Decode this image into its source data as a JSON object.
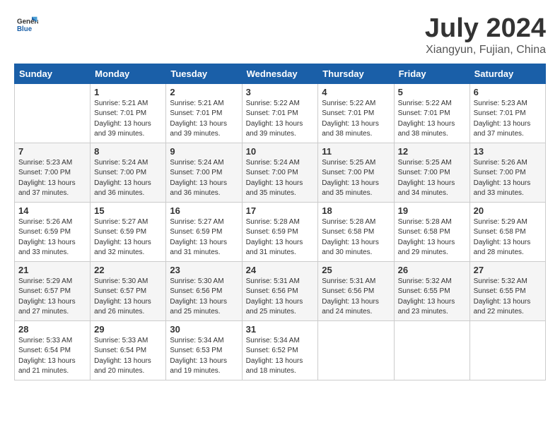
{
  "header": {
    "logo_general": "General",
    "logo_blue": "Blue",
    "month_title": "July 2024",
    "location": "Xiangyun, Fujian, China"
  },
  "weekdays": [
    "Sunday",
    "Monday",
    "Tuesday",
    "Wednesday",
    "Thursday",
    "Friday",
    "Saturday"
  ],
  "weeks": [
    [
      {
        "day": "",
        "sunrise": "",
        "sunset": "",
        "daylight": ""
      },
      {
        "day": "1",
        "sunrise": "Sunrise: 5:21 AM",
        "sunset": "Sunset: 7:01 PM",
        "daylight": "Daylight: 13 hours and 39 minutes."
      },
      {
        "day": "2",
        "sunrise": "Sunrise: 5:21 AM",
        "sunset": "Sunset: 7:01 PM",
        "daylight": "Daylight: 13 hours and 39 minutes."
      },
      {
        "day": "3",
        "sunrise": "Sunrise: 5:22 AM",
        "sunset": "Sunset: 7:01 PM",
        "daylight": "Daylight: 13 hours and 39 minutes."
      },
      {
        "day": "4",
        "sunrise": "Sunrise: 5:22 AM",
        "sunset": "Sunset: 7:01 PM",
        "daylight": "Daylight: 13 hours and 38 minutes."
      },
      {
        "day": "5",
        "sunrise": "Sunrise: 5:22 AM",
        "sunset": "Sunset: 7:01 PM",
        "daylight": "Daylight: 13 hours and 38 minutes."
      },
      {
        "day": "6",
        "sunrise": "Sunrise: 5:23 AM",
        "sunset": "Sunset: 7:01 PM",
        "daylight": "Daylight: 13 hours and 37 minutes."
      }
    ],
    [
      {
        "day": "7",
        "sunrise": "Sunrise: 5:23 AM",
        "sunset": "Sunset: 7:00 PM",
        "daylight": "Daylight: 13 hours and 37 minutes."
      },
      {
        "day": "8",
        "sunrise": "Sunrise: 5:24 AM",
        "sunset": "Sunset: 7:00 PM",
        "daylight": "Daylight: 13 hours and 36 minutes."
      },
      {
        "day": "9",
        "sunrise": "Sunrise: 5:24 AM",
        "sunset": "Sunset: 7:00 PM",
        "daylight": "Daylight: 13 hours and 36 minutes."
      },
      {
        "day": "10",
        "sunrise": "Sunrise: 5:24 AM",
        "sunset": "Sunset: 7:00 PM",
        "daylight": "Daylight: 13 hours and 35 minutes."
      },
      {
        "day": "11",
        "sunrise": "Sunrise: 5:25 AM",
        "sunset": "Sunset: 7:00 PM",
        "daylight": "Daylight: 13 hours and 35 minutes."
      },
      {
        "day": "12",
        "sunrise": "Sunrise: 5:25 AM",
        "sunset": "Sunset: 7:00 PM",
        "daylight": "Daylight: 13 hours and 34 minutes."
      },
      {
        "day": "13",
        "sunrise": "Sunrise: 5:26 AM",
        "sunset": "Sunset: 7:00 PM",
        "daylight": "Daylight: 13 hours and 33 minutes."
      }
    ],
    [
      {
        "day": "14",
        "sunrise": "Sunrise: 5:26 AM",
        "sunset": "Sunset: 6:59 PM",
        "daylight": "Daylight: 13 hours and 33 minutes."
      },
      {
        "day": "15",
        "sunrise": "Sunrise: 5:27 AM",
        "sunset": "Sunset: 6:59 PM",
        "daylight": "Daylight: 13 hours and 32 minutes."
      },
      {
        "day": "16",
        "sunrise": "Sunrise: 5:27 AM",
        "sunset": "Sunset: 6:59 PM",
        "daylight": "Daylight: 13 hours and 31 minutes."
      },
      {
        "day": "17",
        "sunrise": "Sunrise: 5:28 AM",
        "sunset": "Sunset: 6:59 PM",
        "daylight": "Daylight: 13 hours and 31 minutes."
      },
      {
        "day": "18",
        "sunrise": "Sunrise: 5:28 AM",
        "sunset": "Sunset: 6:58 PM",
        "daylight": "Daylight: 13 hours and 30 minutes."
      },
      {
        "day": "19",
        "sunrise": "Sunrise: 5:28 AM",
        "sunset": "Sunset: 6:58 PM",
        "daylight": "Daylight: 13 hours and 29 minutes."
      },
      {
        "day": "20",
        "sunrise": "Sunrise: 5:29 AM",
        "sunset": "Sunset: 6:58 PM",
        "daylight": "Daylight: 13 hours and 28 minutes."
      }
    ],
    [
      {
        "day": "21",
        "sunrise": "Sunrise: 5:29 AM",
        "sunset": "Sunset: 6:57 PM",
        "daylight": "Daylight: 13 hours and 27 minutes."
      },
      {
        "day": "22",
        "sunrise": "Sunrise: 5:30 AM",
        "sunset": "Sunset: 6:57 PM",
        "daylight": "Daylight: 13 hours and 26 minutes."
      },
      {
        "day": "23",
        "sunrise": "Sunrise: 5:30 AM",
        "sunset": "Sunset: 6:56 PM",
        "daylight": "Daylight: 13 hours and 25 minutes."
      },
      {
        "day": "24",
        "sunrise": "Sunrise: 5:31 AM",
        "sunset": "Sunset: 6:56 PM",
        "daylight": "Daylight: 13 hours and 25 minutes."
      },
      {
        "day": "25",
        "sunrise": "Sunrise: 5:31 AM",
        "sunset": "Sunset: 6:56 PM",
        "daylight": "Daylight: 13 hours and 24 minutes."
      },
      {
        "day": "26",
        "sunrise": "Sunrise: 5:32 AM",
        "sunset": "Sunset: 6:55 PM",
        "daylight": "Daylight: 13 hours and 23 minutes."
      },
      {
        "day": "27",
        "sunrise": "Sunrise: 5:32 AM",
        "sunset": "Sunset: 6:55 PM",
        "daylight": "Daylight: 13 hours and 22 minutes."
      }
    ],
    [
      {
        "day": "28",
        "sunrise": "Sunrise: 5:33 AM",
        "sunset": "Sunset: 6:54 PM",
        "daylight": "Daylight: 13 hours and 21 minutes."
      },
      {
        "day": "29",
        "sunrise": "Sunrise: 5:33 AM",
        "sunset": "Sunset: 6:54 PM",
        "daylight": "Daylight: 13 hours and 20 minutes."
      },
      {
        "day": "30",
        "sunrise": "Sunrise: 5:34 AM",
        "sunset": "Sunset: 6:53 PM",
        "daylight": "Daylight: 13 hours and 19 minutes."
      },
      {
        "day": "31",
        "sunrise": "Sunrise: 5:34 AM",
        "sunset": "Sunset: 6:52 PM",
        "daylight": "Daylight: 13 hours and 18 minutes."
      },
      {
        "day": "",
        "sunrise": "",
        "sunset": "",
        "daylight": ""
      },
      {
        "day": "",
        "sunrise": "",
        "sunset": "",
        "daylight": ""
      },
      {
        "day": "",
        "sunrise": "",
        "sunset": "",
        "daylight": ""
      }
    ]
  ]
}
